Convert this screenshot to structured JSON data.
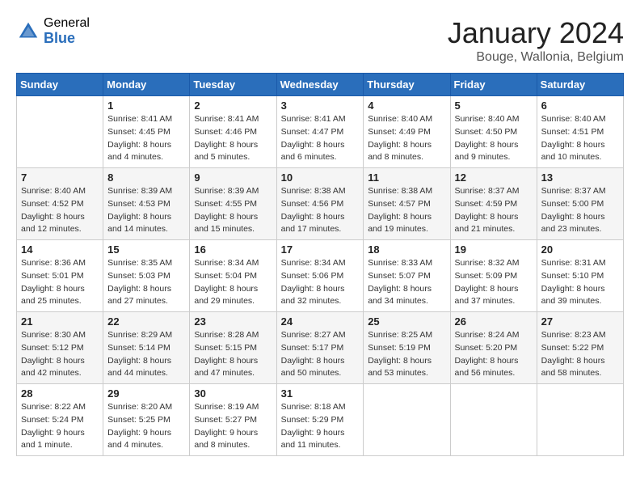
{
  "header": {
    "logo_general": "General",
    "logo_blue": "Blue",
    "month_title": "January 2024",
    "subtitle": "Bouge, Wallonia, Belgium"
  },
  "weekdays": [
    "Sunday",
    "Monday",
    "Tuesday",
    "Wednesday",
    "Thursday",
    "Friday",
    "Saturday"
  ],
  "weeks": [
    [
      {
        "day": "",
        "sunrise": "",
        "sunset": "",
        "daylight": ""
      },
      {
        "day": "1",
        "sunrise": "Sunrise: 8:41 AM",
        "sunset": "Sunset: 4:45 PM",
        "daylight": "Daylight: 8 hours and 4 minutes."
      },
      {
        "day": "2",
        "sunrise": "Sunrise: 8:41 AM",
        "sunset": "Sunset: 4:46 PM",
        "daylight": "Daylight: 8 hours and 5 minutes."
      },
      {
        "day": "3",
        "sunrise": "Sunrise: 8:41 AM",
        "sunset": "Sunset: 4:47 PM",
        "daylight": "Daylight: 8 hours and 6 minutes."
      },
      {
        "day": "4",
        "sunrise": "Sunrise: 8:40 AM",
        "sunset": "Sunset: 4:49 PM",
        "daylight": "Daylight: 8 hours and 8 minutes."
      },
      {
        "day": "5",
        "sunrise": "Sunrise: 8:40 AM",
        "sunset": "Sunset: 4:50 PM",
        "daylight": "Daylight: 8 hours and 9 minutes."
      },
      {
        "day": "6",
        "sunrise": "Sunrise: 8:40 AM",
        "sunset": "Sunset: 4:51 PM",
        "daylight": "Daylight: 8 hours and 10 minutes."
      }
    ],
    [
      {
        "day": "7",
        "sunrise": "Sunrise: 8:40 AM",
        "sunset": "Sunset: 4:52 PM",
        "daylight": "Daylight: 8 hours and 12 minutes."
      },
      {
        "day": "8",
        "sunrise": "Sunrise: 8:39 AM",
        "sunset": "Sunset: 4:53 PM",
        "daylight": "Daylight: 8 hours and 14 minutes."
      },
      {
        "day": "9",
        "sunrise": "Sunrise: 8:39 AM",
        "sunset": "Sunset: 4:55 PM",
        "daylight": "Daylight: 8 hours and 15 minutes."
      },
      {
        "day": "10",
        "sunrise": "Sunrise: 8:38 AM",
        "sunset": "Sunset: 4:56 PM",
        "daylight": "Daylight: 8 hours and 17 minutes."
      },
      {
        "day": "11",
        "sunrise": "Sunrise: 8:38 AM",
        "sunset": "Sunset: 4:57 PM",
        "daylight": "Daylight: 8 hours and 19 minutes."
      },
      {
        "day": "12",
        "sunrise": "Sunrise: 8:37 AM",
        "sunset": "Sunset: 4:59 PM",
        "daylight": "Daylight: 8 hours and 21 minutes."
      },
      {
        "day": "13",
        "sunrise": "Sunrise: 8:37 AM",
        "sunset": "Sunset: 5:00 PM",
        "daylight": "Daylight: 8 hours and 23 minutes."
      }
    ],
    [
      {
        "day": "14",
        "sunrise": "Sunrise: 8:36 AM",
        "sunset": "Sunset: 5:01 PM",
        "daylight": "Daylight: 8 hours and 25 minutes."
      },
      {
        "day": "15",
        "sunrise": "Sunrise: 8:35 AM",
        "sunset": "Sunset: 5:03 PM",
        "daylight": "Daylight: 8 hours and 27 minutes."
      },
      {
        "day": "16",
        "sunrise": "Sunrise: 8:34 AM",
        "sunset": "Sunset: 5:04 PM",
        "daylight": "Daylight: 8 hours and 29 minutes."
      },
      {
        "day": "17",
        "sunrise": "Sunrise: 8:34 AM",
        "sunset": "Sunset: 5:06 PM",
        "daylight": "Daylight: 8 hours and 32 minutes."
      },
      {
        "day": "18",
        "sunrise": "Sunrise: 8:33 AM",
        "sunset": "Sunset: 5:07 PM",
        "daylight": "Daylight: 8 hours and 34 minutes."
      },
      {
        "day": "19",
        "sunrise": "Sunrise: 8:32 AM",
        "sunset": "Sunset: 5:09 PM",
        "daylight": "Daylight: 8 hours and 37 minutes."
      },
      {
        "day": "20",
        "sunrise": "Sunrise: 8:31 AM",
        "sunset": "Sunset: 5:10 PM",
        "daylight": "Daylight: 8 hours and 39 minutes."
      }
    ],
    [
      {
        "day": "21",
        "sunrise": "Sunrise: 8:30 AM",
        "sunset": "Sunset: 5:12 PM",
        "daylight": "Daylight: 8 hours and 42 minutes."
      },
      {
        "day": "22",
        "sunrise": "Sunrise: 8:29 AM",
        "sunset": "Sunset: 5:14 PM",
        "daylight": "Daylight: 8 hours and 44 minutes."
      },
      {
        "day": "23",
        "sunrise": "Sunrise: 8:28 AM",
        "sunset": "Sunset: 5:15 PM",
        "daylight": "Daylight: 8 hours and 47 minutes."
      },
      {
        "day": "24",
        "sunrise": "Sunrise: 8:27 AM",
        "sunset": "Sunset: 5:17 PM",
        "daylight": "Daylight: 8 hours and 50 minutes."
      },
      {
        "day": "25",
        "sunrise": "Sunrise: 8:25 AM",
        "sunset": "Sunset: 5:19 PM",
        "daylight": "Daylight: 8 hours and 53 minutes."
      },
      {
        "day": "26",
        "sunrise": "Sunrise: 8:24 AM",
        "sunset": "Sunset: 5:20 PM",
        "daylight": "Daylight: 8 hours and 56 minutes."
      },
      {
        "day": "27",
        "sunrise": "Sunrise: 8:23 AM",
        "sunset": "Sunset: 5:22 PM",
        "daylight": "Daylight: 8 hours and 58 minutes."
      }
    ],
    [
      {
        "day": "28",
        "sunrise": "Sunrise: 8:22 AM",
        "sunset": "Sunset: 5:24 PM",
        "daylight": "Daylight: 9 hours and 1 minute."
      },
      {
        "day": "29",
        "sunrise": "Sunrise: 8:20 AM",
        "sunset": "Sunset: 5:25 PM",
        "daylight": "Daylight: 9 hours and 4 minutes."
      },
      {
        "day": "30",
        "sunrise": "Sunrise: 8:19 AM",
        "sunset": "Sunset: 5:27 PM",
        "daylight": "Daylight: 9 hours and 8 minutes."
      },
      {
        "day": "31",
        "sunrise": "Sunrise: 8:18 AM",
        "sunset": "Sunset: 5:29 PM",
        "daylight": "Daylight: 9 hours and 11 minutes."
      },
      {
        "day": "",
        "sunrise": "",
        "sunset": "",
        "daylight": ""
      },
      {
        "day": "",
        "sunrise": "",
        "sunset": "",
        "daylight": ""
      },
      {
        "day": "",
        "sunrise": "",
        "sunset": "",
        "daylight": ""
      }
    ]
  ]
}
